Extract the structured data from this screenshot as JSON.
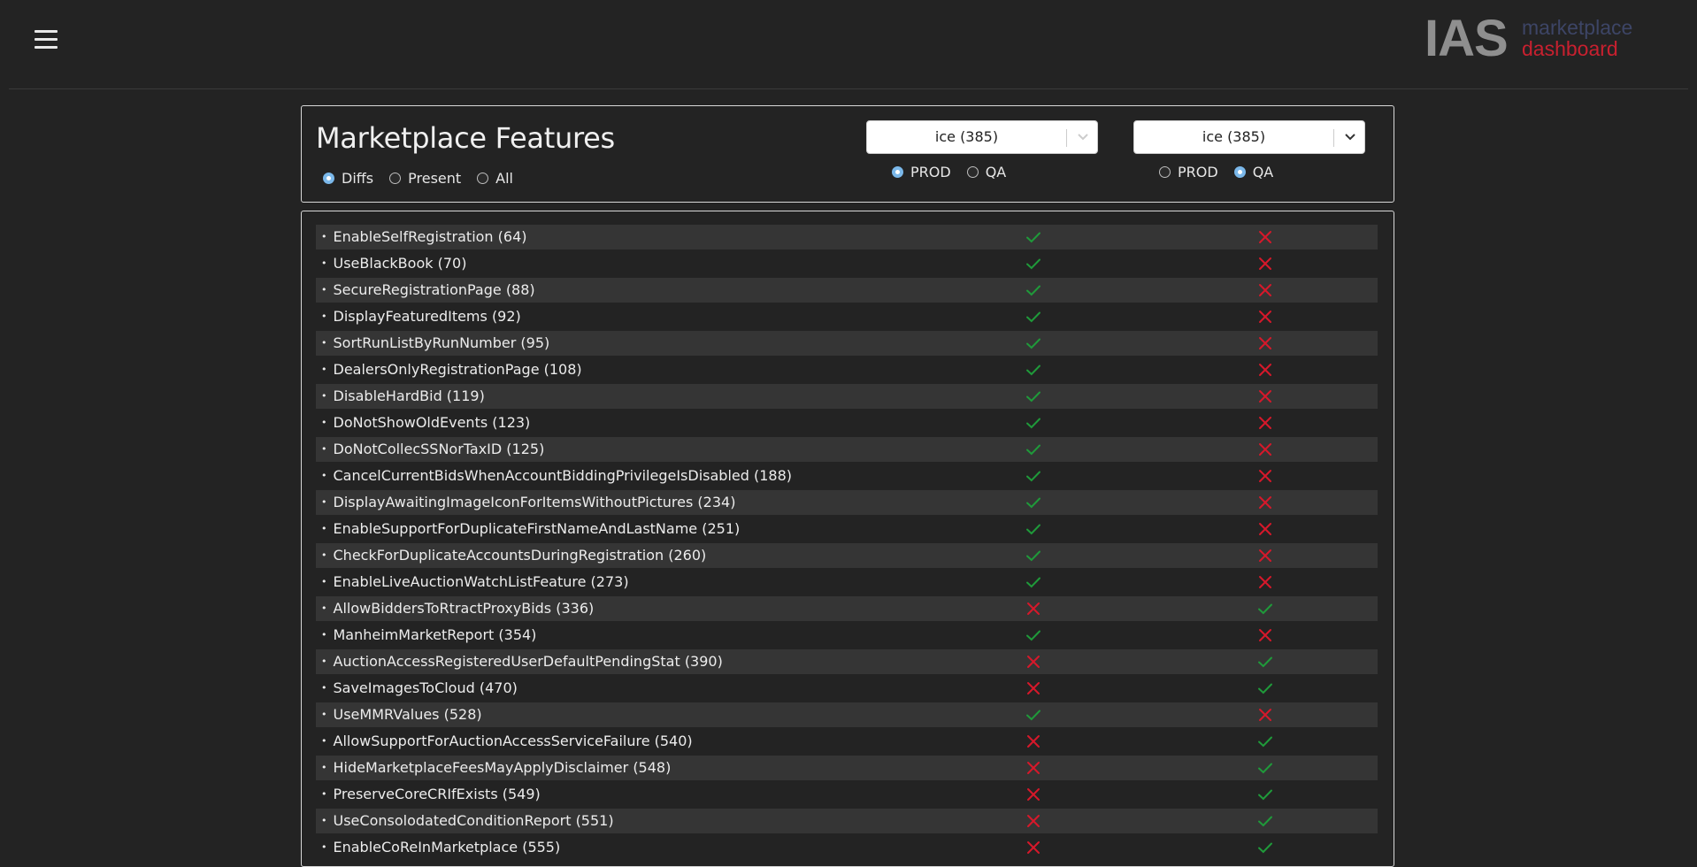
{
  "header": {
    "menu_icon": "hamburger-menu-icon",
    "logo": {
      "brand": "IAS",
      "line1": "marketplace",
      "line2": "dashboard"
    }
  },
  "title": "Marketplace Features",
  "filters": [
    {
      "label": "Diffs",
      "checked": true
    },
    {
      "label": "Present",
      "checked": false
    },
    {
      "label": "All",
      "checked": false
    }
  ],
  "left_env": {
    "select_value": "ice (385)",
    "options": [
      {
        "label": "PROD",
        "checked": true
      },
      {
        "label": "QA",
        "checked": false
      }
    ]
  },
  "right_env": {
    "select_value": "ice (385)",
    "options": [
      {
        "label": "PROD",
        "checked": false
      },
      {
        "label": "QA",
        "checked": true
      }
    ]
  },
  "colors": {
    "check": "#1f9a3a",
    "cross": "#d7182a",
    "radio_on": "#7bb8ea"
  },
  "features": [
    {
      "name": "EnableSelfRegistration (64)",
      "left": true,
      "right": false
    },
    {
      "name": "UseBlackBook (70)",
      "left": true,
      "right": false
    },
    {
      "name": "SecureRegistrationPage (88)",
      "left": true,
      "right": false
    },
    {
      "name": "DisplayFeaturedItems (92)",
      "left": true,
      "right": false
    },
    {
      "name": "SortRunListByRunNumber (95)",
      "left": true,
      "right": false
    },
    {
      "name": "DealersOnlyRegistrationPage (108)",
      "left": true,
      "right": false
    },
    {
      "name": "DisableHardBid (119)",
      "left": true,
      "right": false
    },
    {
      "name": "DoNotShowOldEvents (123)",
      "left": true,
      "right": false
    },
    {
      "name": "DoNotCollecSSNorTaxID (125)",
      "left": true,
      "right": false
    },
    {
      "name": "CancelCurrentBidsWhenAccountBiddingPrivilegeIsDisabled (188)",
      "left": true,
      "right": false
    },
    {
      "name": "DisplayAwaitingImageIconForItemsWithoutPictures (234)",
      "left": true,
      "right": false
    },
    {
      "name": "EnableSupportForDuplicateFirstNameAndLastName (251)",
      "left": true,
      "right": false
    },
    {
      "name": "CheckForDuplicateAccountsDuringRegistration (260)",
      "left": true,
      "right": false
    },
    {
      "name": "EnableLiveAuctionWatchListFeature (273)",
      "left": true,
      "right": false
    },
    {
      "name": "AllowBiddersToRtractProxyBids (336)",
      "left": false,
      "right": true
    },
    {
      "name": "ManheimMarketReport (354)",
      "left": true,
      "right": false
    },
    {
      "name": "AuctionAccessRegisteredUserDefaultPendingStat (390)",
      "left": false,
      "right": true
    },
    {
      "name": "SaveImagesToCloud (470)",
      "left": false,
      "right": true
    },
    {
      "name": "UseMMRValues (528)",
      "left": true,
      "right": false
    },
    {
      "name": "AllowSupportForAuctionAccessServiceFailure (540)",
      "left": false,
      "right": true
    },
    {
      "name": "HideMarketplaceFeesMayApplyDisclaimer (548)",
      "left": false,
      "right": true
    },
    {
      "name": "PreserveCoreCRIfExists (549)",
      "left": false,
      "right": true
    },
    {
      "name": "UseConsolodatedConditionReport (551)",
      "left": false,
      "right": true
    },
    {
      "name": "EnableCoReInMarketplace (555)",
      "left": false,
      "right": true
    }
  ]
}
